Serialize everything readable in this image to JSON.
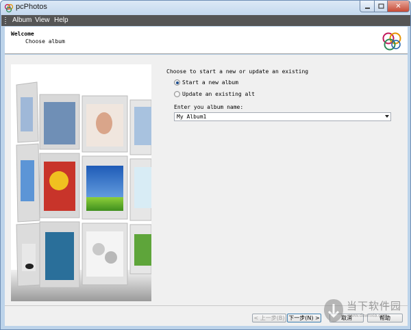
{
  "window": {
    "title": "pcPhotos",
    "close_glyph": "✕"
  },
  "menu": {
    "items": [
      "Album",
      "View",
      "Help"
    ]
  },
  "header": {
    "title": "Welcome",
    "subtitle": "Choose album"
  },
  "form": {
    "prompt": "Choose to start a new or update an existing",
    "options": [
      {
        "label": "Start a new album",
        "selected": true
      },
      {
        "label": "Update an existing alt",
        "selected": false
      }
    ],
    "name_label": "Enter you album name:",
    "name_value": "My Album1"
  },
  "buttons": {
    "back": "< 上一步(B)",
    "next": "下一步(N) >",
    "cancel": "取消",
    "help": "帮助"
  },
  "watermark": {
    "text": "当下软件园",
    "url": "www.downxia.com"
  },
  "icons": {
    "app": "app-logo-icon",
    "brand": "circles-logo-icon",
    "watermark": "downxia-logo-icon"
  }
}
